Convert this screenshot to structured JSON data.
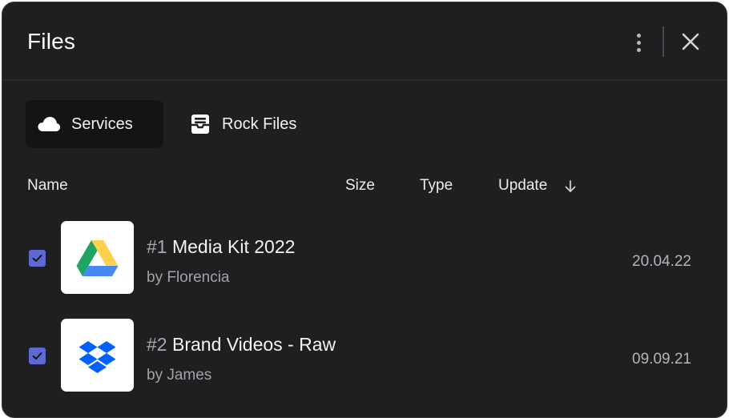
{
  "dialog": {
    "title": "Files",
    "more_icon": "more-vertical-icon",
    "close_icon": "close-icon"
  },
  "tabs": [
    {
      "label": "Services",
      "icon": "cloud-icon",
      "active": true
    },
    {
      "label": "Rock Files",
      "icon": "inbox-tray-icon",
      "active": false
    }
  ],
  "columns": {
    "name": "Name",
    "size": "Size",
    "type": "Type",
    "update": "Update",
    "sort_icon": "arrow-down-icon"
  },
  "files": [
    {
      "number": "#1",
      "name": "Media Kit 2022",
      "author": "by Florencia",
      "date": "20.04.22",
      "checked": true,
      "service_icon": "google-drive-icon"
    },
    {
      "number": "#2",
      "name": "Brand Videos - Raw",
      "author": "by James",
      "date": "09.09.21",
      "checked": true,
      "service_icon": "dropbox-icon"
    }
  ],
  "colors": {
    "panel_bg": "#1f1f21",
    "checkbox_accent": "#5e6ad2",
    "drive_green": "#1fa463",
    "drive_yellow": "#ffd04b",
    "drive_blue": "#4688f4",
    "dropbox_blue": "#0061fe"
  }
}
